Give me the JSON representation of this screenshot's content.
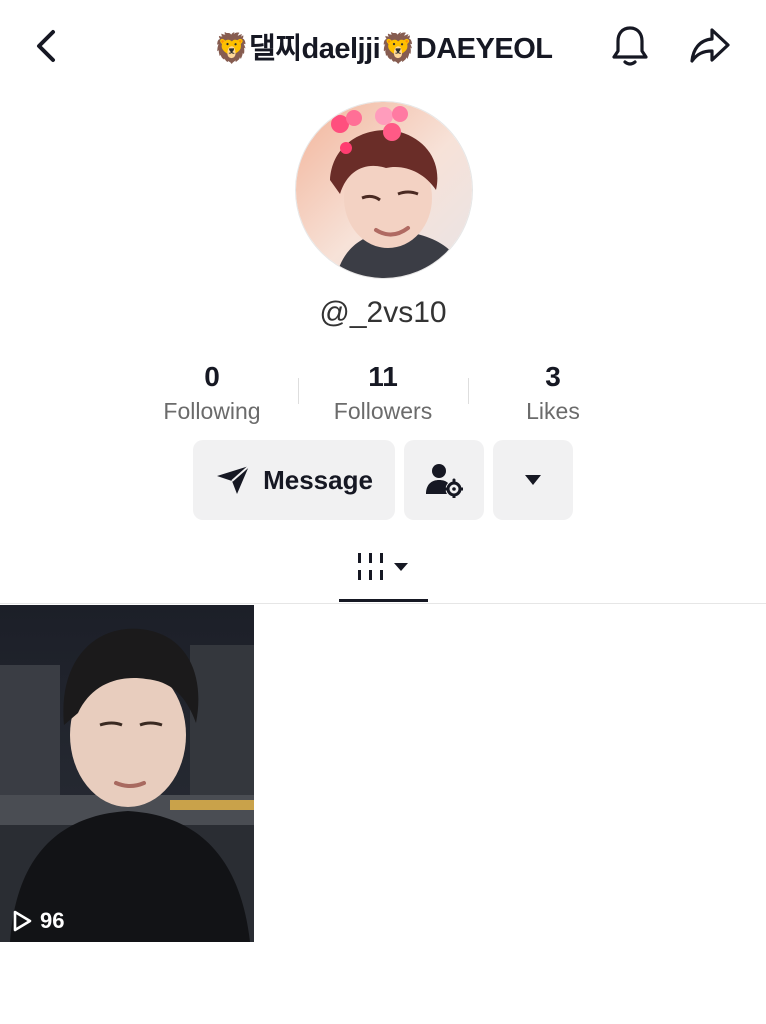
{
  "header": {
    "title": "🦁댈찌daeljji🦁DAEYEOL",
    "back_icon": "chevron-left-icon",
    "bell_icon": "bell-icon",
    "share_icon": "share-arrow-icon"
  },
  "profile": {
    "username": "@_2vs10",
    "avatar": "avatar-photo"
  },
  "stats": [
    {
      "value": "0",
      "label": "Following"
    },
    {
      "value": "11",
      "label": "Followers"
    },
    {
      "value": "3",
      "label": "Likes"
    }
  ],
  "actions": {
    "message_label": "Message",
    "message_icon": "send-icon",
    "follow_settings_icon": "user-gear-icon",
    "more_icon": "caret-down-icon"
  },
  "tabs": {
    "active": "videos",
    "videos_icon": "grid-lines-icon"
  },
  "videos": [
    {
      "views": "96"
    }
  ],
  "colors": {
    "text": "#161823",
    "secondary": "#6b6b6b",
    "button_bg": "#f1f1f2"
  }
}
